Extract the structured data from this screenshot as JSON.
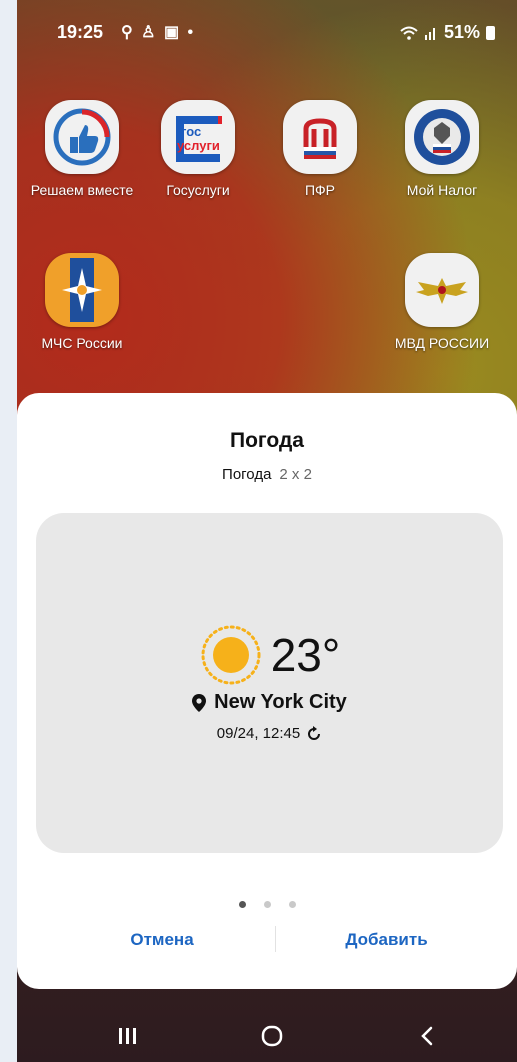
{
  "status_bar": {
    "time": "19:25",
    "left_icons": [
      "search-icon",
      "accessibility-icon",
      "gallery-icon",
      "notification-dot"
    ],
    "battery": "51%",
    "right_icons": [
      "wifi-icon",
      "signal-icon",
      "battery-icon"
    ]
  },
  "home_apps": [
    {
      "label": "Решаем вместе",
      "icon": "thumbs-up-icon"
    },
    {
      "label": "Госуслуги",
      "icon": "gosuslugi-logo",
      "logo_text": "гос\nуслуги"
    },
    {
      "label": "ПФР",
      "icon": "pfr-logo"
    },
    {
      "label": "Мой Налог",
      "icon": "tax-service-emblem"
    },
    {
      "label": "МЧС России",
      "icon": "mchs-emblem"
    },
    {
      "label": "МВД РОССИИ",
      "icon": "mvd-eagle-emblem"
    }
  ],
  "widget_sheet": {
    "title": "Погода",
    "widget_name": "Погода",
    "widget_size": "2 x 2",
    "preview": {
      "weather_icon": "sun-icon",
      "temperature": "23°",
      "location_icon": "location-pin-icon",
      "city": "New York City",
      "updated": "09/24, 12:45",
      "refresh_icon": "refresh-icon"
    },
    "page_indicator": {
      "count": 3,
      "active": 0
    },
    "cancel_label": "Отмена",
    "add_label": "Добавить"
  },
  "nav_bar": {
    "recents_icon": "recents-icon",
    "home_icon": "home-icon",
    "back_icon": "back-icon"
  },
  "colors": {
    "accent_button": "#1d66c2",
    "sheet_background": "#ffffff",
    "preview_background": "#e8e8e8",
    "sun": "#f6b11a"
  }
}
